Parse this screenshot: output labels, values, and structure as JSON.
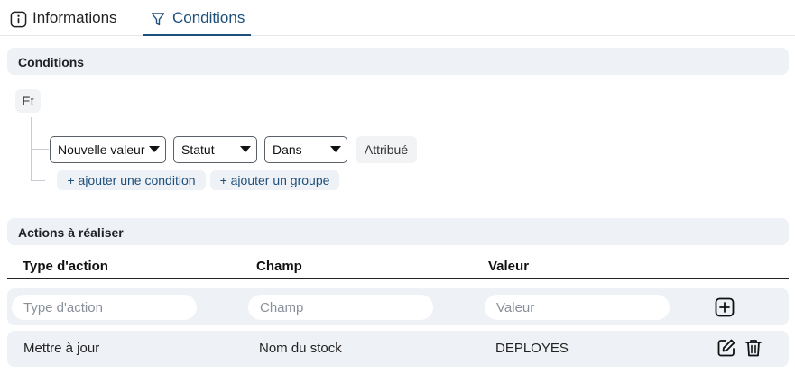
{
  "tabs": [
    {
      "label": "Informations",
      "icon": "info-icon",
      "active": false
    },
    {
      "label": "Conditions",
      "icon": "filter-icon",
      "active": true
    }
  ],
  "conditions": {
    "title": "Conditions",
    "group_operator": "Et",
    "rule": {
      "field_select": "Nouvelle valeur",
      "attribute_select": "Statut",
      "operator_select": "Dans",
      "value_chip": "Attribué"
    },
    "add_condition_label": "+ ajouter une condition",
    "add_group_label": "+ ajouter un groupe"
  },
  "actions": {
    "title": "Actions à réaliser",
    "columns": [
      "Type d'action",
      "Champ",
      "Valeur"
    ],
    "new_row": {
      "type_placeholder": "Type d'action",
      "field_placeholder": "Champ",
      "value_placeholder": "Valeur"
    },
    "rows": [
      {
        "type": "Mettre à jour",
        "field": "Nom du stock",
        "value": "DEPLOYES"
      }
    ]
  },
  "colors": {
    "accent": "#1d4f7c",
    "section_bg": "#eef1f5"
  }
}
